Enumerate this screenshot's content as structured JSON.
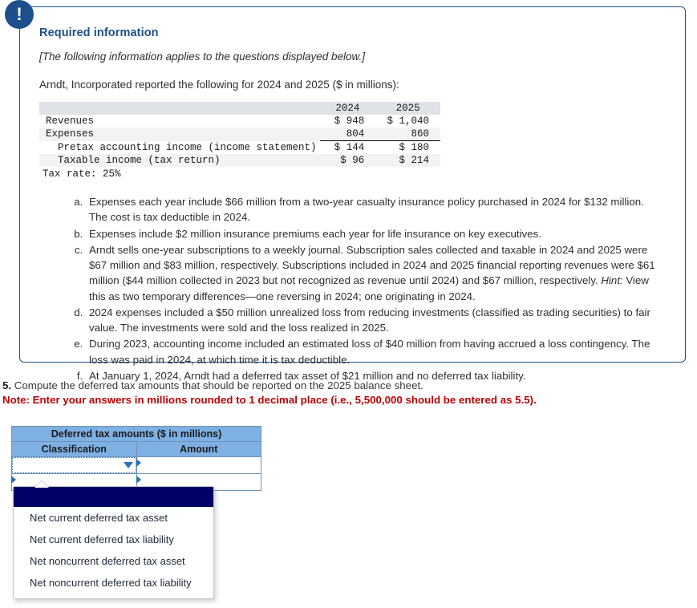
{
  "alert": {
    "icon": "exclamation-icon",
    "glyph": "!"
  },
  "panel": {
    "title": "Required information",
    "italic_note": "[The following information applies to the questions displayed below.]",
    "lead": "Arndt, Incorporated reported the following for 2024 and 2025 ($ in millions):",
    "table": {
      "columns": [
        "",
        "2024",
        "2025"
      ],
      "rows": [
        {
          "label": "Revenues",
          "v2024": "$ 948",
          "v2025": "$ 1,040"
        },
        {
          "label": "Expenses",
          "v2024": "804",
          "v2025": "860"
        },
        {
          "label": "  Pretax accounting income (income statement)",
          "v2024": "$ 144",
          "v2025": "$ 180"
        },
        {
          "label": "  Taxable income (tax return)",
          "v2024": "$ 96",
          "v2025": "$ 214"
        }
      ],
      "tax_rate_line": "Tax rate: 25%"
    },
    "items": [
      "Expenses each year include $66 million from a two-year casualty insurance policy purchased in 2024 for $132 million. The cost is tax deductible in 2024.",
      "Expenses include $2 million insurance premiums each year for life insurance on key executives.",
      "Arndt sells one-year subscriptions to a weekly journal. Subscription sales collected and taxable in 2024 and 2025 were $67 million and $83 million, respectively. Subscriptions included in 2024 and 2025 financial reporting revenues were $61 million ($44 million collected in 2023 but not recognized as revenue until 2024) and $67 million, respectively. Hint: View this as two temporary differences—one reversing in 2024; one originating in 2024.",
      "2024 expenses included a $50 million unrealized loss from reducing investments (classified as trading securities) to fair value. The investments were sold and the loss realized in 2025.",
      "During 2023, accounting income included an estimated loss of $40 million from having accrued a loss contingency. The loss was paid in 2024, at which time it is tax deductible.",
      "At January 1, 2024, Arndt had a deferred tax asset of $21 million and no deferred tax liability."
    ]
  },
  "question": {
    "number": "5.",
    "text": "Compute the deferred tax amounts that should be reported on the 2025 balance sheet.",
    "note": "Note: Enter your answers in millions rounded to 1 decimal place (i.e., 5,500,000 should be entered as 5.5)."
  },
  "answer_table": {
    "title": "Deferred tax amounts ($ in millions)",
    "headers": [
      "Classification",
      "Amount"
    ],
    "rows": [
      {
        "classification": "",
        "amount": ""
      },
      {
        "classification": "",
        "amount": ""
      }
    ]
  },
  "dropdown": {
    "selected": "",
    "options": [
      "Net current deferred tax asset",
      "Net current deferred tax liability",
      "Net noncurrent deferred tax asset",
      "Net noncurrent deferred tax liability"
    ]
  },
  "colors": {
    "panel_border": "#1c4f8b",
    "badge": "#1c4f8b",
    "title_blue": "#1c4f8b",
    "note_red": "#c00000",
    "table_header_blue": "#7eb0e4",
    "dropdown_selected_navy": "#000066"
  }
}
